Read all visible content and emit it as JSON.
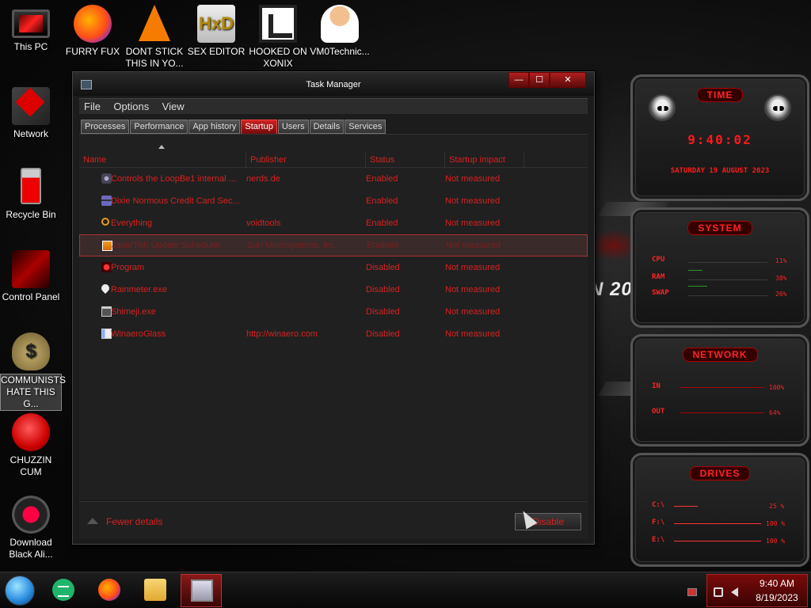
{
  "desktop": {
    "icons": [
      {
        "label": "This PC"
      },
      {
        "label": "FURRY FUX"
      },
      {
        "label": "DONT STICK THIS IN YO..."
      },
      {
        "label": "SEX EDITOR"
      },
      {
        "label": "HOOKED ON XONIX"
      },
      {
        "label": "VM0Technic..."
      },
      {
        "label": "Network"
      },
      {
        "label": "Recycle Bin"
      },
      {
        "label": "Control Panel"
      },
      {
        "label": "COMMUNISTS HATE THIS G..."
      },
      {
        "label": "CHUZZIN CUM"
      },
      {
        "label": "Download Black Ali..."
      }
    ],
    "hxd_glyph": "HxD",
    "money_glyph": "$",
    "bg_text": "N 20"
  },
  "task_manager": {
    "title": "Task Manager",
    "window_buttons": {
      "minimize": "—",
      "maximize": "☐",
      "close": "✕"
    },
    "menu": [
      "File",
      "Options",
      "View"
    ],
    "tabs": [
      "Processes",
      "Performance",
      "App history",
      "Startup",
      "Users",
      "Details",
      "Services"
    ],
    "active_tab": "Startup",
    "columns": [
      "Name",
      "Publisher",
      "Status",
      "Startup impact"
    ],
    "rows": [
      {
        "icon": "camera-icon",
        "name": "Controls the LoopBe1 internal ...",
        "publisher": "nerds.de",
        "status": "Enabled",
        "impact": "Not measured"
      },
      {
        "icon": "credit-card-icon",
        "name": "Dixie Normous Credit Card Sec...",
        "publisher": "",
        "status": "Enabled",
        "impact": "Not measured"
      },
      {
        "icon": "search-icon",
        "name": "Everything",
        "publisher": "voidtools",
        "status": "Enabled",
        "impact": "Not measured"
      },
      {
        "icon": "java-icon",
        "name": "Java(TM) Update Scheduler",
        "publisher": "Sun Microsystems, Inc.",
        "status": "Enabled",
        "impact": "Not measured"
      },
      {
        "icon": "program-icon",
        "name": "Program",
        "publisher": "",
        "status": "Disabled",
        "impact": "Not measured"
      },
      {
        "icon": "droplet-icon",
        "name": "Rainmeter.exe",
        "publisher": "",
        "status": "Disabled",
        "impact": "Not measured"
      },
      {
        "icon": "window-icon",
        "name": "Shimeji.exe",
        "publisher": "",
        "status": "Disabled",
        "impact": "Not measured"
      },
      {
        "icon": "app-window-icon",
        "name": "WinaeroGlass",
        "publisher": "http://winaero.com",
        "status": "Disabled",
        "impact": "Not measured"
      }
    ],
    "selected_row": 3,
    "footer": {
      "fewer_details": "Fewer details",
      "disable_button": "Disable"
    }
  },
  "gadgets": {
    "clock": {
      "title": "TIME",
      "time": "9:40:02",
      "date": "SATURDAY 19 AUGUST 2023"
    },
    "system": {
      "title": "SYSTEM",
      "cpu_label": "CPU",
      "cpu_val": "11%",
      "ram_label": "RAM",
      "ram_val": "38%",
      "swap_label": "SWAP",
      "swap_val": "26%"
    },
    "network": {
      "title": "NETWORK",
      "in_label": "IN",
      "in_val": "100%",
      "out_label": "OUT",
      "out_val": "64%"
    },
    "drives": {
      "title": "DRIVES",
      "c_label": "C:\\",
      "c_val": "25 %",
      "f_label": "F:\\",
      "f_val": "100 %",
      "e_label": "E:\\",
      "e_val": "100 %"
    }
  },
  "taskbar": {
    "items": [
      "start-orb",
      "sheets",
      "firefox",
      "file-explorer",
      "task-manager"
    ],
    "active": "task-manager",
    "tray_time": "9:40 AM",
    "tray_date": "8/19/2023"
  },
  "colors": {
    "accent": "#d82020",
    "tray": "#7a0a0a"
  }
}
